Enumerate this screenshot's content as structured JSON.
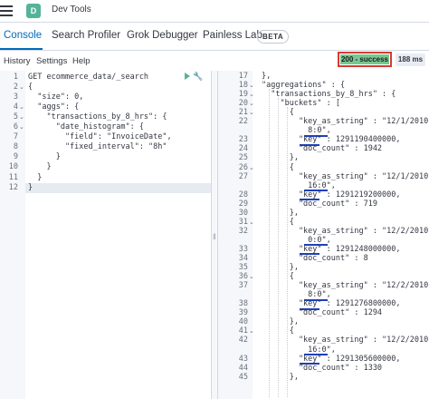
{
  "header": {
    "app_badge": "D",
    "app_title": "Dev Tools"
  },
  "tabs": [
    {
      "label": "Console",
      "active": true
    },
    {
      "label": "Search Profiler",
      "active": false
    },
    {
      "label": "Grok Debugger",
      "active": false
    },
    {
      "label": "Painless Lab",
      "active": false
    }
  ],
  "beta_badge": "BETA",
  "toolbar": {
    "history": "History",
    "settings": "Settings",
    "help": "Help",
    "status": "200 - success",
    "timing": "188 ms"
  },
  "request": {
    "lines": [
      {
        "n": "1",
        "text": "GET ecommerce_data/_search"
      },
      {
        "n": "2",
        "text": "{"
      },
      {
        "n": "3",
        "text": "  \"size\": 0,"
      },
      {
        "n": "4",
        "text": "  \"aggs\": {"
      },
      {
        "n": "5",
        "text": "    \"transactions_by_8_hrs\": {"
      },
      {
        "n": "6",
        "text": "      \"date_histogram\": {"
      },
      {
        "n": "7",
        "text": "        \"field\": \"InvoiceDate\","
      },
      {
        "n": "8",
        "text": "        \"fixed_interval\": \"8h\""
      },
      {
        "n": "9",
        "text": "      }"
      },
      {
        "n": "10",
        "text": "    }"
      },
      {
        "n": "11",
        "text": "  }"
      },
      {
        "n": "12",
        "text": "}"
      }
    ]
  },
  "response": {
    "lines": [
      {
        "n": "17",
        "text": "},"
      },
      {
        "n": "18",
        "text": "\"aggregations\" : {"
      },
      {
        "n": "19",
        "text": "  \"transactions_by_8_hrs\" : {"
      },
      {
        "n": "20",
        "text": "    \"buckets\" : ["
      },
      {
        "n": "21",
        "text": "      {"
      },
      {
        "n": "22",
        "text": "        \"key_as_string\" : \"12/1/2010"
      },
      {
        "n": "",
        "text": "          8:0\","
      },
      {
        "n": "23",
        "text": "        \"key\" : 1291190400000,"
      },
      {
        "n": "24",
        "text": "        \"doc_count\" : 1942"
      },
      {
        "n": "25",
        "text": "      },"
      },
      {
        "n": "26",
        "text": "      {"
      },
      {
        "n": "27",
        "text": "        \"key_as_string\" : \"12/1/2010"
      },
      {
        "n": "",
        "text": "          16:0\","
      },
      {
        "n": "28",
        "text": "        \"key\" : 1291219200000,"
      },
      {
        "n": "29",
        "text": "        \"doc_count\" : 719"
      },
      {
        "n": "30",
        "text": "      },"
      },
      {
        "n": "31",
        "text": "      {"
      },
      {
        "n": "32",
        "text": "        \"key_as_string\" : \"12/2/2010"
      },
      {
        "n": "",
        "text": "          0:0\","
      },
      {
        "n": "33",
        "text": "        \"key\" : 1291248000000,"
      },
      {
        "n": "34",
        "text": "        \"doc_count\" : 8"
      },
      {
        "n": "35",
        "text": "      },"
      },
      {
        "n": "36",
        "text": "      {"
      },
      {
        "n": "37",
        "text": "        \"key_as_string\" : \"12/2/2010"
      },
      {
        "n": "",
        "text": "          8:0\","
      },
      {
        "n": "38",
        "text": "        \"key\" : 1291276800000,"
      },
      {
        "n": "39",
        "text": "        \"doc_count\" : 1294"
      },
      {
        "n": "40",
        "text": "      },"
      },
      {
        "n": "41",
        "text": "      {"
      },
      {
        "n": "42",
        "text": "        \"key_as_string\" : \"12/2/2010"
      },
      {
        "n": "",
        "text": "          16:0\","
      },
      {
        "n": "43",
        "text": "        \"key\" : 1291305600000,"
      },
      {
        "n": "44",
        "text": "        \"doc_count\" : 1330"
      },
      {
        "n": "45",
        "text": "      },"
      }
    ]
  },
  "colors": {
    "accent": "#006bb8",
    "status_bg": "#7ac68f",
    "status_border": "#d93a32",
    "highlight_underline": "#1c3fbf"
  }
}
